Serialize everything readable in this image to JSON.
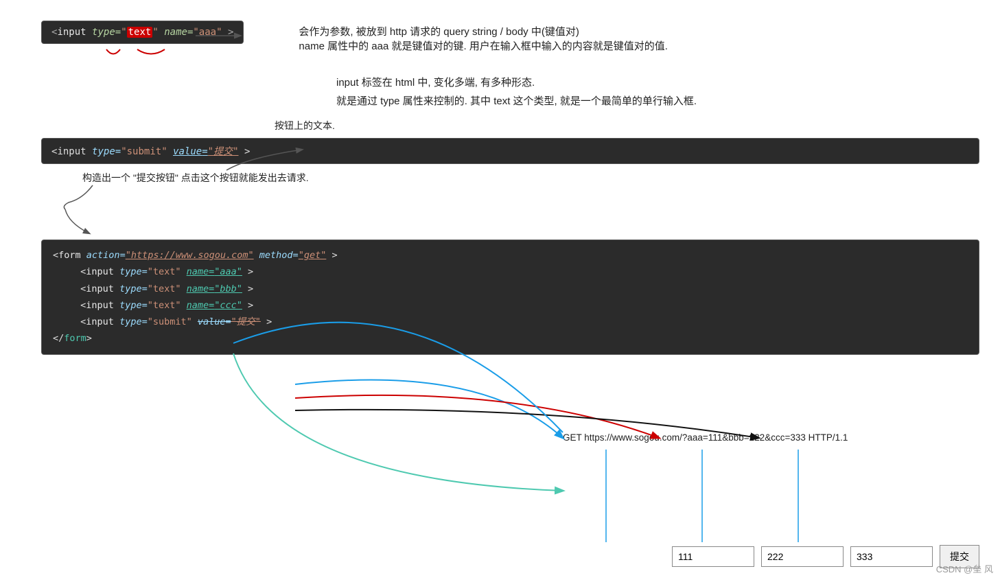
{
  "top_code": {
    "display": "<input type=\"text\" name=\"aaa\">"
  },
  "top_annotation_1": "会作为参数, 被放到 http 请求的 query string / body 中(键值对)",
  "top_annotation_2": "name 属性中的 aaa 就是键值对的键. 用户在输入框中输入的内容就是键值对的值.",
  "second_text_1": "input 标签在 html 中, 变化多端, 有多种形态.",
  "second_text_2": "就是通过 type 属性来控制的.  其中 text 这个类型, 就是一个最简单的单行输入框.",
  "submit_code": {
    "display": "<input type=\"submit\" value=\"提交\">"
  },
  "submit_annotation_top": "按钮上的文本.",
  "submit_annotation_bottom": "构造出一个 \"提交按钮\" 点击这个按钮就能发出去请求.",
  "form_code": {
    "line1": "<form action=\"https://www.sogou.com\" method=\"get\">",
    "line2": "    <input type=\"text\" name=\"aaa\">",
    "line3": "    <input type=\"text\" name=\"bbb\">",
    "line4": "    <input type=\"text\" name=\"ccc\">",
    "line5": "    <input type=\"submit\" value=\"提交\">",
    "line6": "</form>"
  },
  "get_url": "GET https://www.sogou.com/?aaa=111&bbb=222&ccc=333 HTTP/1.1",
  "input_aaa_value": "111",
  "input_bbb_value": "222",
  "input_ccc_value": "333",
  "submit_button_label": "提交",
  "csdn_watermark": "CSDN @垒 风"
}
